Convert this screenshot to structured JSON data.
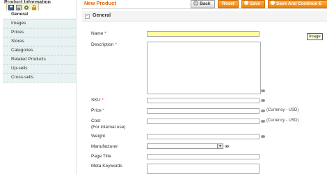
{
  "sidebar": {
    "heading": "Product Information",
    "toolbar": {
      "icons": [
        "save-icon",
        "floppy-icon",
        "settings-icon",
        "lock-icon"
      ],
      "colors": [
        "#2a5fa8",
        "#7a7a7a",
        "#4a8a3a",
        "#d08a00"
      ]
    },
    "tabs": [
      {
        "label": "General"
      },
      {
        "label": "Images"
      },
      {
        "label": "Prices"
      },
      {
        "label": "Stores"
      },
      {
        "label": "Categories"
      },
      {
        "label": "Related Products"
      },
      {
        "label": "Up-sells"
      },
      {
        "label": "Cross-sells"
      }
    ]
  },
  "header": {
    "title": "New Product",
    "back_label": "Back",
    "reset_label": "Reset",
    "save_label": "Save",
    "save_continue_label": "Save And Continue E"
  },
  "section": {
    "title": "General"
  },
  "form": {
    "name_label": "Name",
    "description_label": "Description",
    "sku_label": "SKU",
    "price_label": "Price",
    "price_scope": "(Currency - USD)",
    "cost_label": "Cost",
    "cost_note": "(For internal use)",
    "cost_scope": "(Currency - USD)",
    "weight_label": "Weight",
    "manufacturer_label": "Manufacturer",
    "page_title_label": "Page Title",
    "meta_keywords_label": "Meta Keywords",
    "required_marker": "*"
  },
  "tooltip": "Image",
  "colors": {
    "accent": "#eb5e00",
    "required": "#eb2e00",
    "highlight_input": "#ffff9c",
    "tab_background": "#e9f2f2"
  }
}
